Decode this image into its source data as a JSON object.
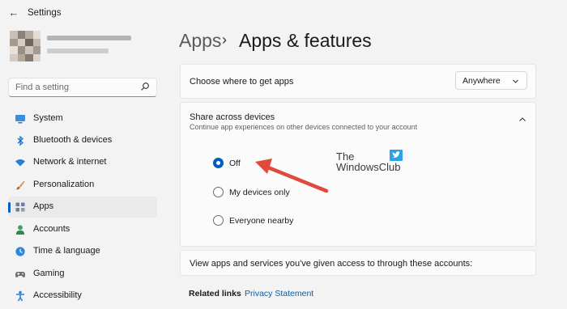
{
  "titlebar": {
    "title": "Settings",
    "back_icon": "back-arrow-icon"
  },
  "search": {
    "placeholder": "Find a setting",
    "icon": "search-icon"
  },
  "nav": {
    "items": [
      {
        "label": "System",
        "icon": "monitor-icon",
        "color": "#1f6fd0",
        "active": false
      },
      {
        "label": "Bluetooth & devices",
        "icon": "bluetooth-icon",
        "color": "#1f6fd0",
        "active": false
      },
      {
        "label": "Network & internet",
        "icon": "wifi-icon",
        "color": "#1f6fd0",
        "active": false
      },
      {
        "label": "Personalization",
        "icon": "brush-icon",
        "color": "#d87a2c",
        "active": false
      },
      {
        "label": "Apps",
        "icon": "apps-icon",
        "color": "#5b6d8a",
        "active": true
      },
      {
        "label": "Accounts",
        "icon": "person-icon",
        "color": "#2e9a55",
        "active": false
      },
      {
        "label": "Time & language",
        "icon": "globe-clock-icon",
        "color": "#1f6fd0",
        "active": false
      },
      {
        "label": "Gaming",
        "icon": "controller-icon",
        "color": "#6b6b6b",
        "active": false
      },
      {
        "label": "Accessibility",
        "icon": "accessibility-icon",
        "color": "#1f6fd0",
        "active": false
      }
    ]
  },
  "header": {
    "parent": "Apps",
    "separator": "›",
    "current": "Apps & features"
  },
  "get_apps": {
    "label": "Choose where to get apps",
    "value": "Anywhere"
  },
  "share": {
    "title": "Share across devices",
    "subtitle": "Continue app experiences on other devices connected to your account",
    "options": [
      {
        "label": "Off",
        "selected": true
      },
      {
        "label": "My devices only",
        "selected": false
      },
      {
        "label": "Everyone nearby",
        "selected": false
      }
    ]
  },
  "watermark": {
    "line1": "The",
    "line2": "WindowsClub"
  },
  "accounts_text": "View apps and services you've given access to through these accounts:",
  "related": {
    "label": "Related links",
    "link": "Privacy Statement"
  },
  "accent_color": "#005fb8",
  "annotation_color": "#e04a3c"
}
